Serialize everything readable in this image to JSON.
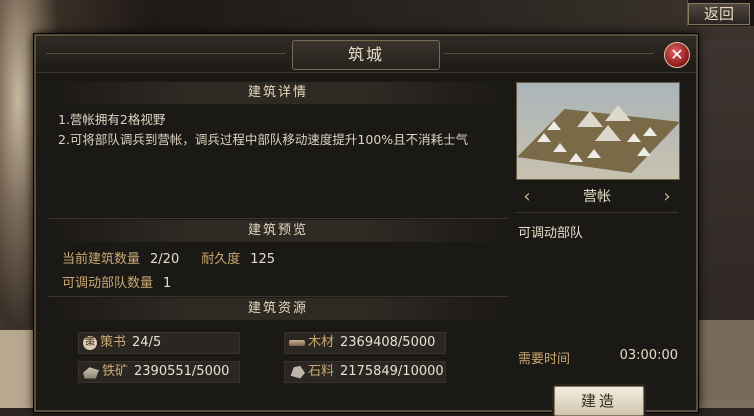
{
  "background": {
    "back_label": "返回"
  },
  "dialog": {
    "title": "筑城",
    "close_icon": "close-icon"
  },
  "detail": {
    "heading": "建筑详情",
    "lines": [
      "1.营帐拥有2格视野",
      "2.可将部队调兵到营帐，调兵过程中部队移动速度提升100%且不消耗士气"
    ]
  },
  "preview": {
    "heading": "建筑预览",
    "count_label": "当前建筑数量",
    "count_value": "2/20",
    "durability_label": "耐久度",
    "durability_value": "125",
    "troops_label": "可调动部队数量",
    "troops_value": "1"
  },
  "resources": {
    "heading": "建筑资源",
    "items": [
      {
        "icon": "decree-icon",
        "icon_text": "策",
        "name": "策书",
        "value": "24/5"
      },
      {
        "icon": "wood-icon",
        "name": "木材",
        "value": "2369408/5000"
      },
      {
        "icon": "iron-icon",
        "name": "铁矿",
        "value": "2390551/5000"
      },
      {
        "icon": "stone-icon",
        "name": "石料",
        "value": "2175849/10000"
      }
    ]
  },
  "building": {
    "name": "营帐",
    "function": "可调动部队",
    "time_label": "需要时间",
    "time_value": "03:00:00",
    "build_label": "建造"
  },
  "colors": {
    "accent": "#c9a872",
    "text": "#e6dcc8",
    "close": "#b82a2a"
  }
}
